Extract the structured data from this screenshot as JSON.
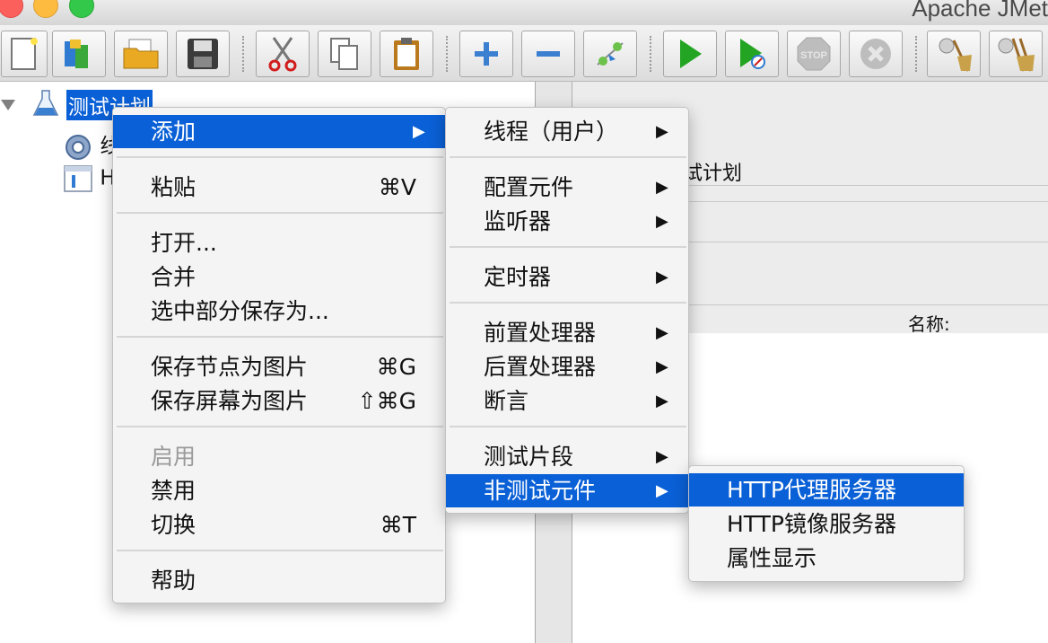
{
  "window": {
    "title": "Apache JMet"
  },
  "toolbar": {
    "icons": [
      "new-icon",
      "templates-icon",
      "open-icon",
      "save-icon",
      "cut-icon",
      "copy-icon",
      "paste-icon",
      "expand-icon",
      "collapse-icon",
      "toggle-icon",
      "start-icon",
      "start-no-pause-icon",
      "stop-icon",
      "shutdown-icon",
      "clear-icon",
      "clear-all-icon"
    ]
  },
  "tree": {
    "root_label": "测试计划",
    "child1_label": "线",
    "child2_label": "H"
  },
  "right_panel": {
    "name_value": "试计划",
    "name_label": "名称:"
  },
  "context_menu": {
    "add": "添加",
    "paste": "粘贴",
    "paste_sc": "⌘V",
    "open": "打开...",
    "merge": "合并",
    "save_selection": "选中部分保存为...",
    "save_node_image": "保存节点为图片",
    "save_node_image_sc": "⌘G",
    "save_screen_image": "保存屏幕为图片",
    "save_screen_image_sc": "⇧⌘G",
    "enable": "启用",
    "disable": "禁用",
    "toggle": "切换",
    "toggle_sc": "⌘T",
    "help": "帮助",
    "arrow": "▶"
  },
  "add_submenu": {
    "threads": "线程（用户）",
    "config": "配置元件",
    "listener": "监听器",
    "timer": "定时器",
    "pre_processor": "前置处理器",
    "post_processor": "后置处理器",
    "assertion": "断言",
    "test_fragment": "测试片段",
    "non_test": "非测试元件",
    "arrow": "▶"
  },
  "non_test_submenu": {
    "http_proxy": "HTTP代理服务器",
    "http_mirror": "HTTP镜像服务器",
    "property_display": "属性显示"
  },
  "colors": {
    "selection": "#0a60d6",
    "menu_bg": "#f4f4f4"
  }
}
